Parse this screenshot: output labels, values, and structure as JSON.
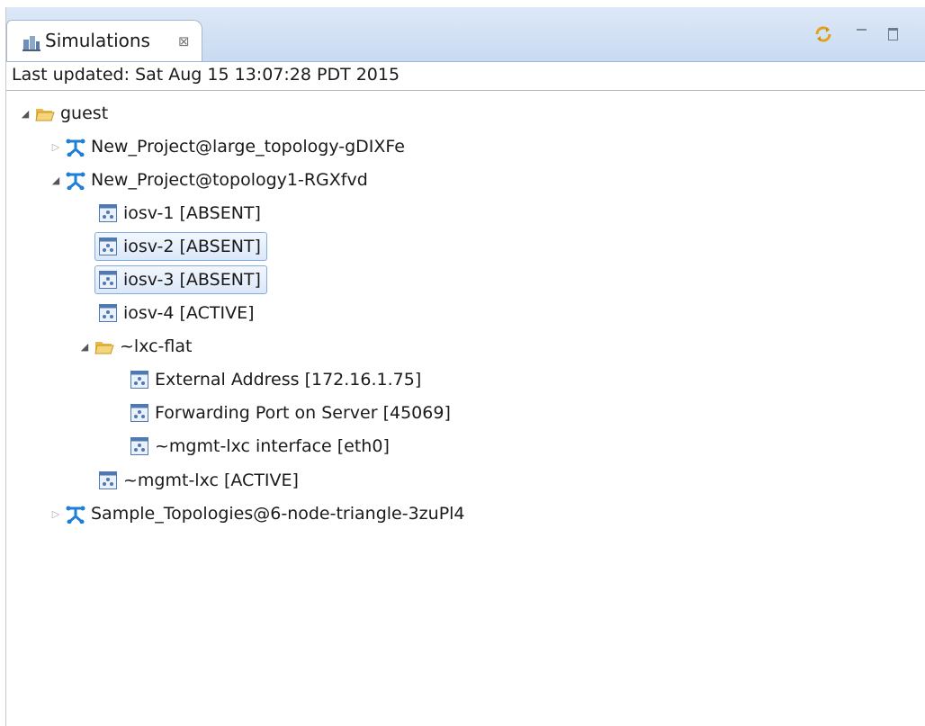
{
  "view": {
    "tab_label": "Simulations",
    "tab_close_glyph": "⊠",
    "tab_icon": "simulations-view-icon",
    "toolbar_icons": [
      "sync-icon",
      "minimize-icon",
      "maximize-icon"
    ]
  },
  "status": {
    "last_updated": "Last updated: Sat Aug 15 13:07:28 PDT 2015"
  },
  "tree": {
    "root": {
      "label": "guest",
      "expanded": true,
      "icon": "folder-open-icon"
    },
    "projects": [
      {
        "label": "New_Project@large_topology-gDIXFe",
        "expanded": false,
        "icon": "topology-icon"
      },
      {
        "label": "New_Project@topology1-RGXfvd",
        "expanded": true,
        "icon": "topology-icon"
      },
      {
        "label": "Sample_Topologies@6-node-triangle-3zuPl4",
        "expanded": false,
        "icon": "topology-icon"
      }
    ],
    "nodes": [
      {
        "label": "iosv-1  [ABSENT]",
        "selected": false,
        "icon": "node-icon"
      },
      {
        "label": "iosv-2  [ABSENT]",
        "selected": true,
        "icon": "node-icon"
      },
      {
        "label": "iosv-3  [ABSENT]",
        "selected": true,
        "icon": "node-icon"
      },
      {
        "label": "iosv-4  [ACTIVE]",
        "selected": false,
        "icon": "node-icon"
      }
    ],
    "lxc_folder": {
      "label": "~lxc-flat",
      "expanded": true,
      "icon": "folder-open-icon"
    },
    "lxc_items": [
      {
        "label": "External Address  [172.16.1.75]",
        "icon": "node-icon"
      },
      {
        "label": "Forwarding Port on Server  [45069]",
        "icon": "node-icon"
      },
      {
        "label": "~mgmt-lxc interface  [eth0]",
        "icon": "node-icon"
      }
    ],
    "mgmt": {
      "label": "~mgmt-lxc  [ACTIVE]",
      "icon": "node-icon"
    }
  },
  "colors": {
    "tabbar_top": "#dce8f7",
    "tabbar_bottom": "#c9dbf2",
    "selection_border": "#84acdd",
    "topology_icon": "#1e7fd6",
    "folder": "#e8b84a"
  }
}
